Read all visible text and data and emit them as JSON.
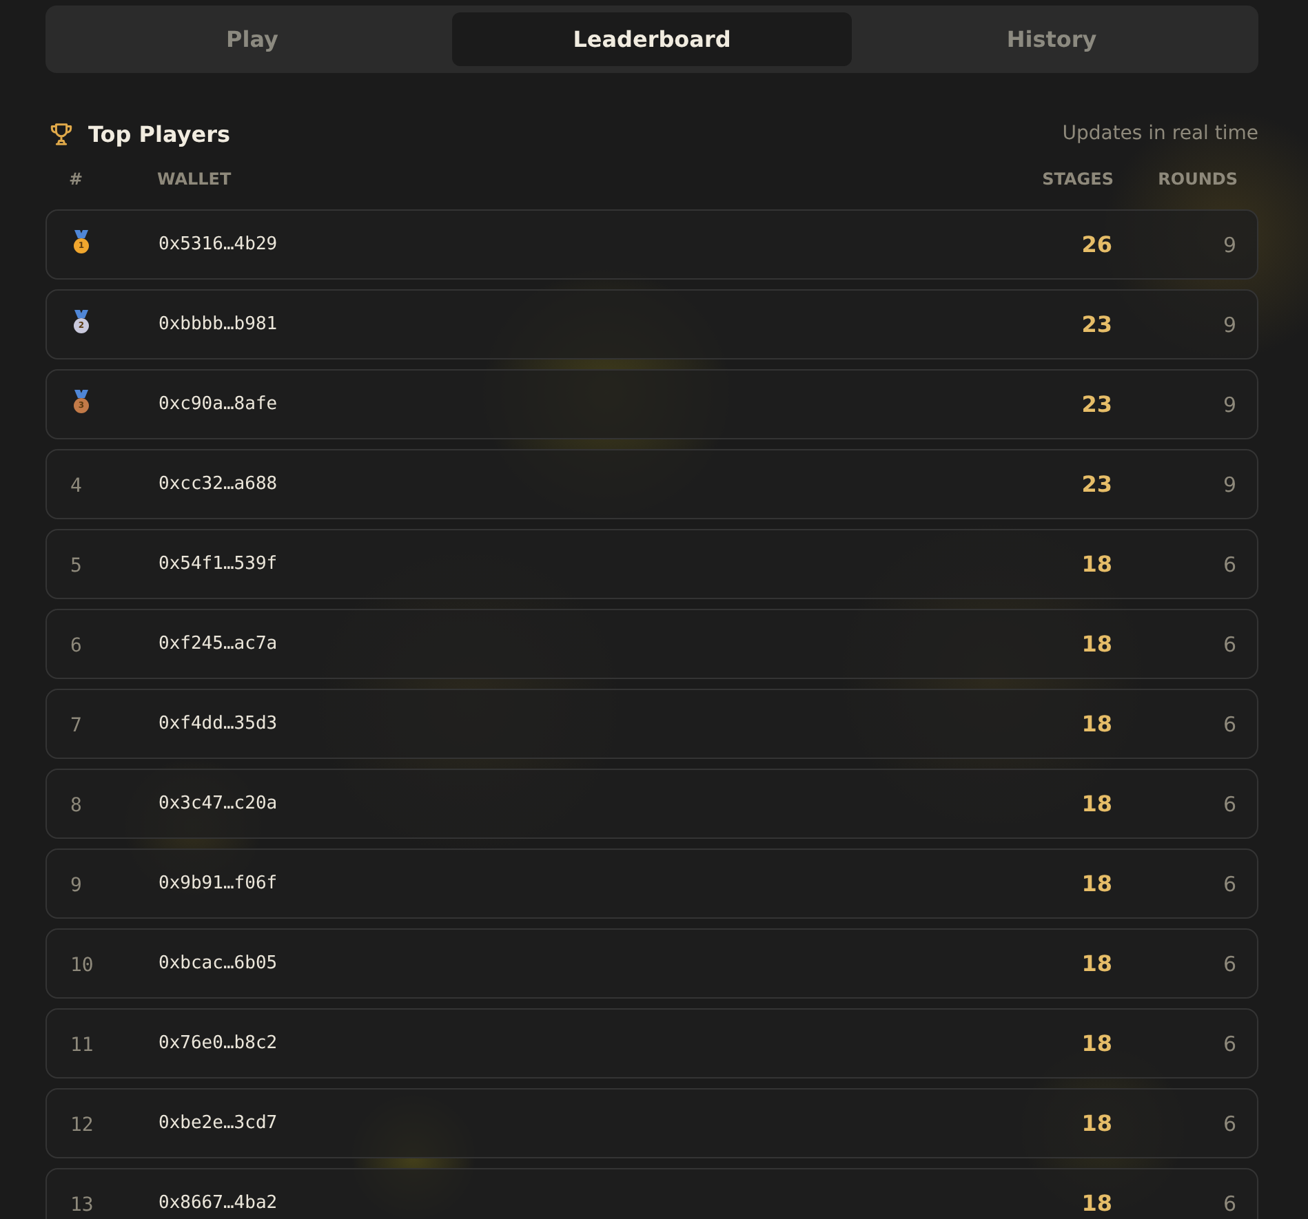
{
  "tabs": [
    {
      "label": "Play",
      "selected": false
    },
    {
      "label": "Leaderboard",
      "selected": true
    },
    {
      "label": "History",
      "selected": false
    }
  ],
  "leaderboard": {
    "title": "Top Players",
    "status": "Updates in real time",
    "columns": [
      "#",
      "WALLET",
      "STAGES",
      "ROUNDS"
    ],
    "rows": [
      {
        "kind": "medal",
        "rank": "1",
        "color": "#f0a62e",
        "wallet": "0x5316…4b29",
        "stages": "26",
        "rounds": "9"
      },
      {
        "kind": "medal",
        "rank": "2",
        "color": "#c9c9dc",
        "wallet": "0xbbbb…b981",
        "stages": "23",
        "rounds": "9"
      },
      {
        "kind": "medal",
        "rank": "3",
        "color": "#c27a48",
        "wallet": "0xc90a…8afe",
        "stages": "23",
        "rounds": "9"
      },
      {
        "kind": "number",
        "rank": "4",
        "wallet": "0xcc32…a688",
        "stages": "23",
        "rounds": "9"
      },
      {
        "kind": "number",
        "rank": "5",
        "wallet": "0x54f1…539f",
        "stages": "18",
        "rounds": "6"
      },
      {
        "kind": "number",
        "rank": "6",
        "wallet": "0xf245…ac7a",
        "stages": "18",
        "rounds": "6"
      },
      {
        "kind": "number",
        "rank": "7",
        "wallet": "0xf4dd…35d3",
        "stages": "18",
        "rounds": "6"
      },
      {
        "kind": "number",
        "rank": "8",
        "wallet": "0x3c47…c20a",
        "stages": "18",
        "rounds": "6"
      },
      {
        "kind": "number",
        "rank": "9",
        "wallet": "0x9b91…f06f",
        "stages": "18",
        "rounds": "6"
      },
      {
        "kind": "number",
        "rank": "10",
        "wallet": "0xbcac…6b05",
        "stages": "18",
        "rounds": "6"
      },
      {
        "kind": "number",
        "rank": "11",
        "wallet": "0x76e0…b8c2",
        "stages": "18",
        "rounds": "6"
      },
      {
        "kind": "number",
        "rank": "12",
        "wallet": "0xbe2e…3cd7",
        "stages": "18",
        "rounds": "6"
      },
      {
        "kind": "number",
        "rank": "13",
        "wallet": "0x8667…4ba2",
        "stages": "18",
        "rounds": "6"
      }
    ]
  }
}
